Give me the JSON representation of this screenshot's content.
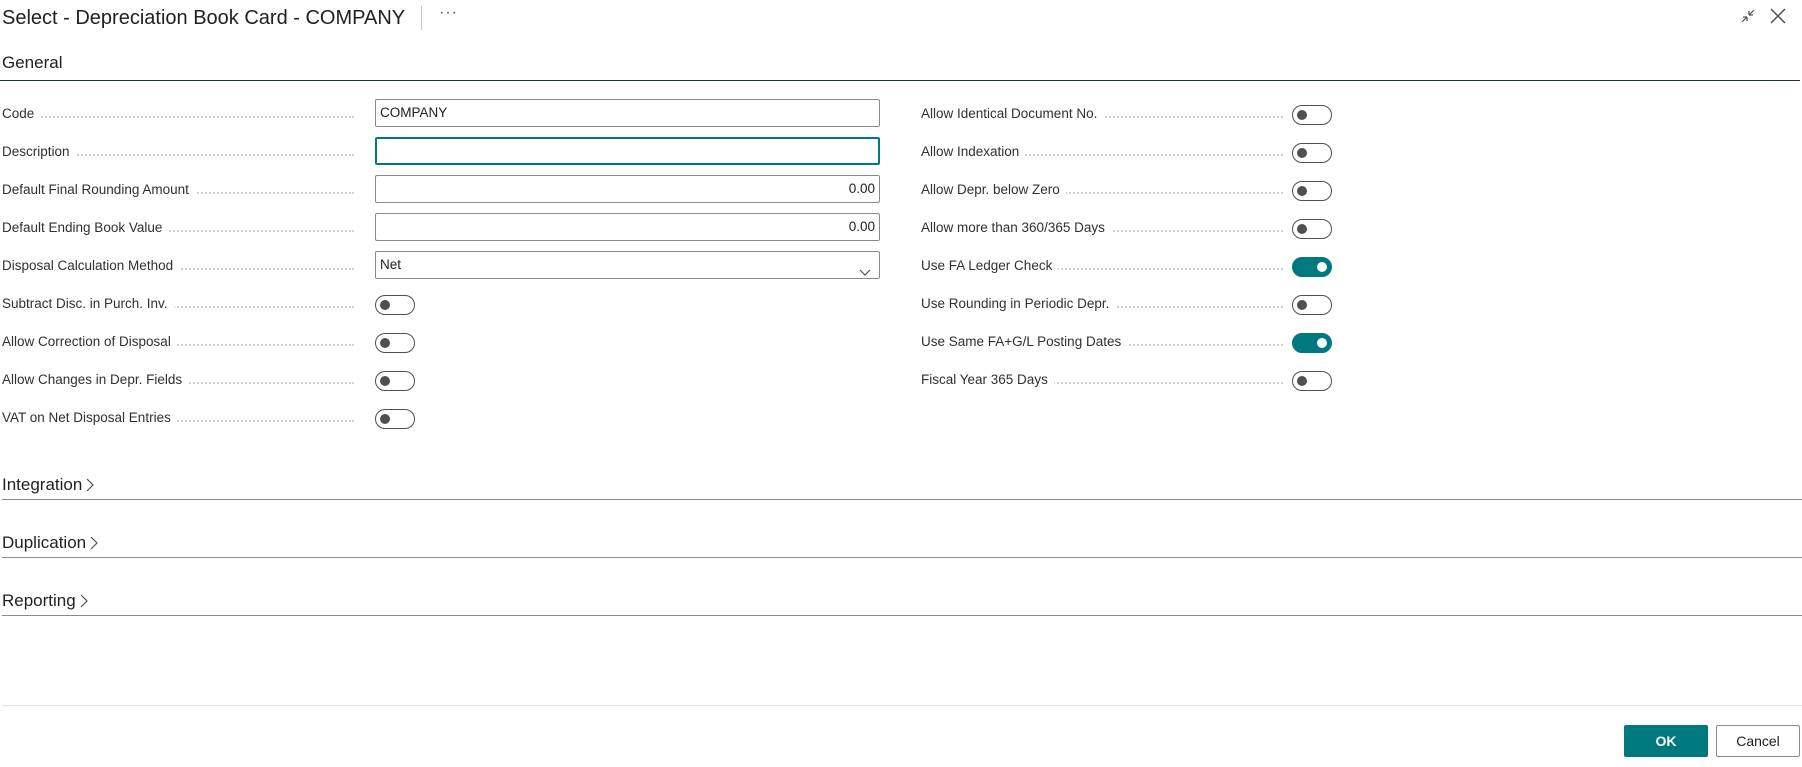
{
  "header": {
    "title": "Select - Depreciation Book Card - COMPANY",
    "more_label": "···"
  },
  "general": {
    "title": "General",
    "left_fields": [
      {
        "label": "Code",
        "value": "COMPANY"
      },
      {
        "label": "Description",
        "value": ""
      },
      {
        "label": "Default Final Rounding Amount",
        "value": "0.00"
      },
      {
        "label": "Default Ending Book Value",
        "value": "0.00"
      },
      {
        "label": "Disposal Calculation Method",
        "value": "Net"
      }
    ],
    "left_toggles": [
      {
        "label": "Subtract Disc. in Purch. Inv.",
        "on": false
      },
      {
        "label": "Allow Correction of Disposal",
        "on": false
      },
      {
        "label": "Allow Changes in Depr. Fields",
        "on": false
      },
      {
        "label": "VAT on Net Disposal Entries",
        "on": false
      }
    ],
    "right_toggles": [
      {
        "label": "Allow Identical Document No.",
        "on": false
      },
      {
        "label": "Allow Indexation",
        "on": false
      },
      {
        "label": "Allow Depr. below Zero",
        "on": false
      },
      {
        "label": "Allow more than 360/365 Days",
        "on": false
      },
      {
        "label": "Use FA Ledger Check",
        "on": true
      },
      {
        "label": "Use Rounding in Periodic Depr.",
        "on": false
      },
      {
        "label": "Use Same FA+G/L Posting Dates",
        "on": true
      },
      {
        "label": "Fiscal Year 365 Days",
        "on": false
      }
    ]
  },
  "sections": {
    "integration": "Integration",
    "duplication": "Duplication",
    "reporting": "Reporting"
  },
  "footer": {
    "ok_label": "OK",
    "cancel_label": "Cancel"
  },
  "colors": {
    "accent": "#00797e",
    "toggle_off": "#505050"
  }
}
